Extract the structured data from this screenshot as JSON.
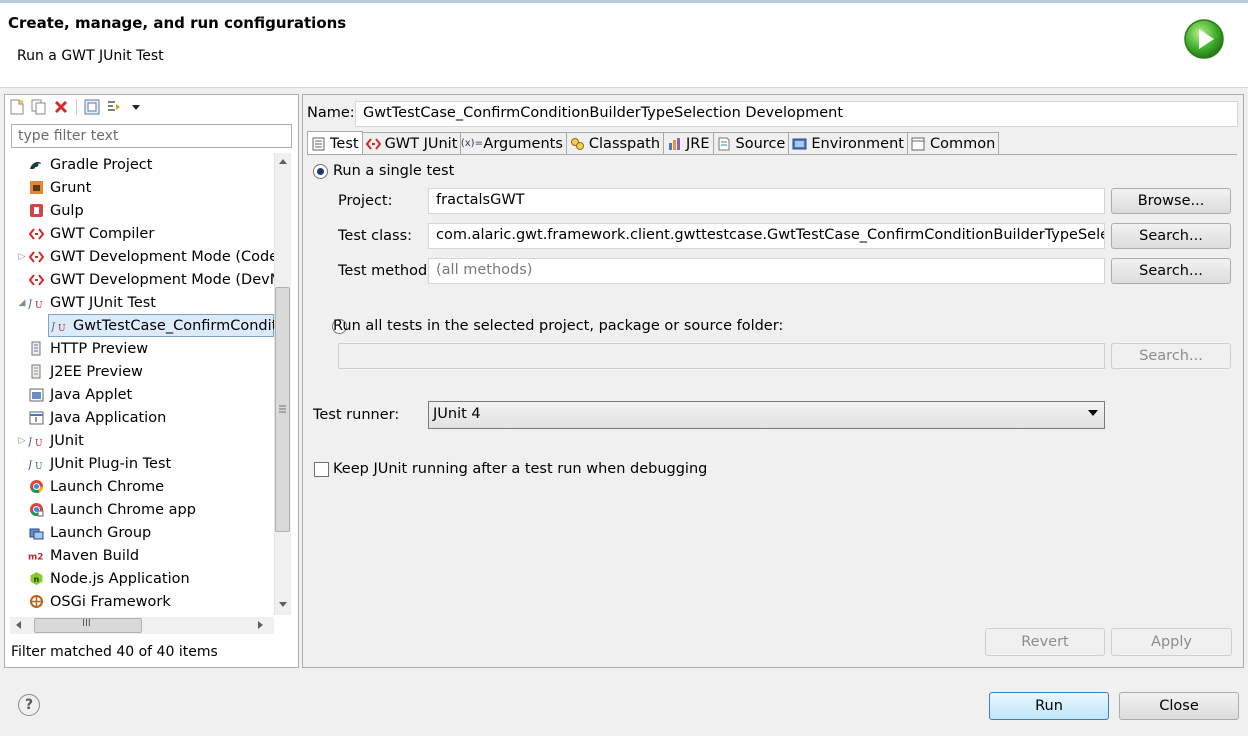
{
  "header": {
    "title": "Create, manage, and run configurations",
    "subtitle": "Run a GWT JUnit Test"
  },
  "left": {
    "filter_placeholder": "type filter text",
    "tree": [
      {
        "label": "Gradle Project",
        "icon": "gradle-icon",
        "level": 1,
        "expander": ""
      },
      {
        "label": "Grunt",
        "icon": "grunt-icon",
        "level": 1,
        "expander": ""
      },
      {
        "label": "Gulp",
        "icon": "gulp-icon",
        "level": 1,
        "expander": ""
      },
      {
        "label": "GWT Compiler",
        "icon": "gwt-icon",
        "level": 1,
        "expander": ""
      },
      {
        "label": "GWT Development Mode (CodeS",
        "icon": "gwt-icon",
        "level": 1,
        "expander": "▷"
      },
      {
        "label": "GWT Development Mode (DevM",
        "icon": "gwt-icon",
        "level": 1,
        "expander": ""
      },
      {
        "label": "GWT JUnit Test",
        "icon": "junit-icon",
        "level": 1,
        "expander": "◢"
      },
      {
        "label": "GwtTestCase_ConfirmConditic",
        "icon": "junit-icon",
        "level": 2,
        "expander": ""
      },
      {
        "label": "HTTP Preview",
        "icon": "http-preview-icon",
        "level": 1,
        "expander": ""
      },
      {
        "label": "J2EE Preview",
        "icon": "j2ee-preview-icon",
        "level": 1,
        "expander": ""
      },
      {
        "label": "Java Applet",
        "icon": "java-applet-icon",
        "level": 1,
        "expander": ""
      },
      {
        "label": "Java Application",
        "icon": "java-application-icon",
        "level": 1,
        "expander": ""
      },
      {
        "label": "JUnit",
        "icon": "junit-icon",
        "level": 1,
        "expander": "▷"
      },
      {
        "label": "JUnit Plug-in Test",
        "icon": "junit-plugin-icon",
        "level": 1,
        "expander": ""
      },
      {
        "label": "Launch Chrome",
        "icon": "chrome-icon",
        "level": 1,
        "expander": ""
      },
      {
        "label": "Launch Chrome app",
        "icon": "chrome-app-icon",
        "level": 1,
        "expander": ""
      },
      {
        "label": "Launch Group",
        "icon": "launch-group-icon",
        "level": 1,
        "expander": ""
      },
      {
        "label": "Maven Build",
        "icon": "maven-icon",
        "level": 1,
        "expander": ""
      },
      {
        "label": "Node.js Application",
        "icon": "nodejs-icon",
        "level": 1,
        "expander": ""
      },
      {
        "label": "OSGi Framework",
        "icon": "osgi-icon",
        "level": 1,
        "expander": ""
      }
    ],
    "selected_index": 7,
    "h_scroll_grip": "III",
    "filter_status": "Filter matched 40 of 40 items"
  },
  "right": {
    "name_label": "Name:",
    "name_value": "GwtTestCase_ConfirmConditionBuilderTypeSelection Development",
    "tabs": [
      {
        "label": "Test",
        "icon": "test-tab-icon"
      },
      {
        "label": "GWT JUnit",
        "icon": "gwt-icon"
      },
      {
        "label": "Arguments",
        "icon": "arguments-icon"
      },
      {
        "label": "Classpath",
        "icon": "classpath-icon"
      },
      {
        "label": "JRE",
        "icon": "jre-icon"
      },
      {
        "label": "Source",
        "icon": "source-icon"
      },
      {
        "label": "Environment",
        "icon": "environment-icon"
      },
      {
        "label": "Common",
        "icon": "common-icon"
      }
    ],
    "active_tab": 0,
    "test": {
      "single_test_label": "Run a single test",
      "single_test_selected": true,
      "project_label": "Project:",
      "project_value": "fractalsGWT",
      "browse_label": "Browse...",
      "test_class_label": "Test class:",
      "test_class_value": "com.alaric.gwt.framework.client.gwttestcase.GwtTestCase_ConfirmConditionBuilderTypeSelection",
      "search_label": "Search...",
      "test_method_label": "Test method:",
      "test_method_placeholder": "(all methods)",
      "all_tests_label": "Run all tests in the selected project, package or source folder:",
      "all_tests_selected": false,
      "container_value": "",
      "runner_label": "Test runner:",
      "runner_value": "JUnit 4",
      "keep_running_label": "Keep JUnit running after a test run when debugging",
      "keep_running_checked": false
    },
    "revert_label": "Revert",
    "apply_label": "Apply"
  },
  "footer": {
    "help_glyph": "?",
    "run_label": "Run",
    "close_label": "Close"
  }
}
